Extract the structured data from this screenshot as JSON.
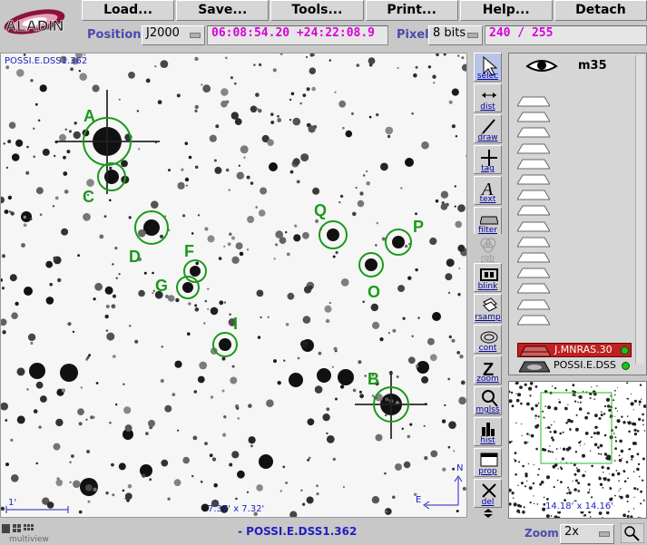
{
  "app": {
    "logo_text": "ALADIN"
  },
  "menu": [
    "Load...",
    "Save...",
    "Tools...",
    "Print...",
    "Help...",
    "Detach"
  ],
  "position": {
    "label": "Position",
    "frame": "J2000",
    "coords": "06:08:54.20 +24:22:08.9"
  },
  "pixel": {
    "label": "Pixel",
    "depth": "8 bits",
    "value": "240 / 255"
  },
  "view": {
    "survey_label": "POSSI.E.DSS1.362",
    "scale_label": "1'",
    "fov_label": "7.37' x 7.32'",
    "compass_n": "N",
    "compass_e": "E",
    "markers": [
      "A",
      "B",
      "C",
      "D",
      "F",
      "G",
      "I",
      "O",
      "P",
      "Q"
    ]
  },
  "tools": [
    {
      "name": "select",
      "label": "selec"
    },
    {
      "name": "dist",
      "label": "dist"
    },
    {
      "name": "draw",
      "label": "draw"
    },
    {
      "name": "tag",
      "label": "tag"
    },
    {
      "name": "text",
      "label": "text"
    },
    {
      "name": "filter",
      "label": "filter"
    },
    {
      "name": "rgb",
      "label": "rgb"
    },
    {
      "name": "blink",
      "label": "blink"
    },
    {
      "name": "rsamp",
      "label": "rsamp"
    },
    {
      "name": "cont",
      "label": "cont"
    },
    {
      "name": "zoom",
      "label": "zoom"
    },
    {
      "name": "mglss",
      "label": "mglss"
    },
    {
      "name": "hist",
      "label": "hist"
    },
    {
      "name": "prop",
      "label": "prop"
    },
    {
      "name": "del",
      "label": "del"
    }
  ],
  "stack": {
    "object": "m35",
    "layers": [
      {
        "name": "J.MNRAS.30",
        "color": "#cc0000"
      },
      {
        "name": "POSSI.E.DSS",
        "color": "#000000"
      }
    ]
  },
  "thumbnail": {
    "fov_label": "14.18' x 14.16'"
  },
  "status": {
    "image_name": "- POSSI.E.DSS1.362",
    "multiview": "multiview"
  },
  "zoom": {
    "label": "Zoom",
    "value": "2x"
  }
}
